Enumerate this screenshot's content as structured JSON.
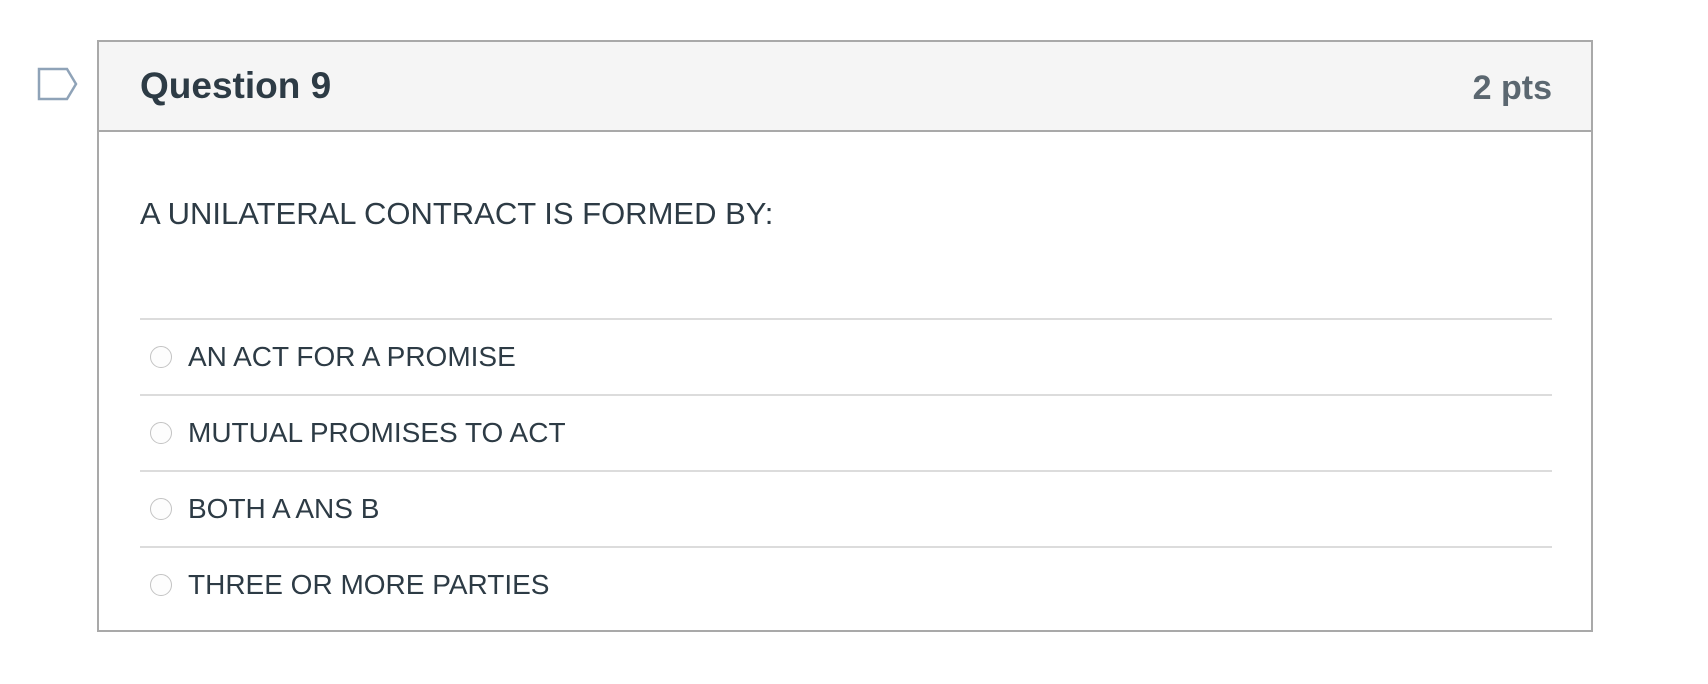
{
  "question": {
    "title": "Question 9",
    "points": "2 pts",
    "text": "A UNILATERAL CONTRACT IS FORMED BY:",
    "answers": [
      {
        "label": "AN ACT FOR A PROMISE",
        "selected": false
      },
      {
        "label": "MUTUAL PROMISES TO ACT",
        "selected": false
      },
      {
        "label": "BOTH A ANS B",
        "selected": false
      },
      {
        "label": "THREE OR MORE PARTIES",
        "selected": false
      }
    ]
  },
  "icons": {
    "flag": "flag-question-icon"
  },
  "colors": {
    "text": "#2d3b45",
    "points": "#5b6770",
    "header_bg": "#f5f5f5",
    "card_border": "#a9a9a9",
    "divider": "#dcdcdc",
    "flag_outline": "#8fa3b8"
  }
}
